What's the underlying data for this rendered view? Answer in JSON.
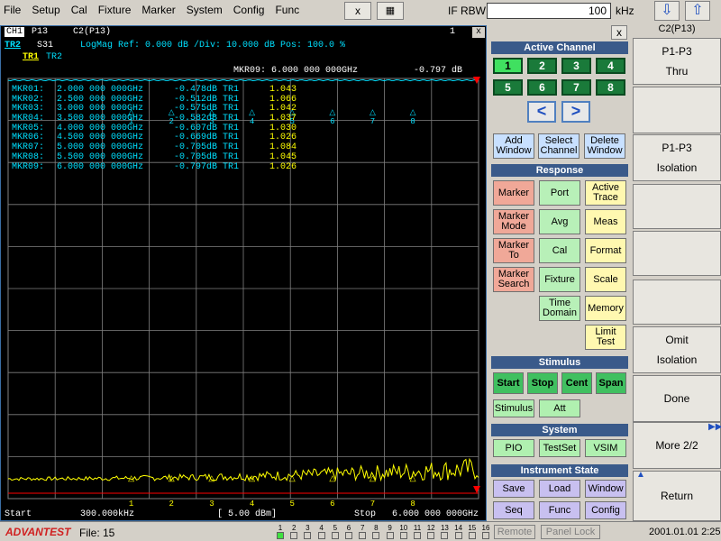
{
  "menu": [
    "File",
    "Setup",
    "Cal",
    "Fixture",
    "Marker",
    "System",
    "Config",
    "Func"
  ],
  "toolbar": {
    "close_label": "x",
    "calc_icon": "calculator-icon",
    "ifrbw_label": "IF RBW",
    "ifrbw_value": "100",
    "ifrbw_unit": "kHz",
    "down_icon": "arrow-down-icon",
    "up_icon": "arrow-up-icon"
  },
  "display": {
    "channel": "CH1",
    "port": "P13",
    "cal": "C2(P13)",
    "window_num": "1",
    "close_label": "x",
    "trace_active": "TR2",
    "sparam": "S31",
    "trace_info": "LogMag  Ref:  0.000 dB  /Div: 10.000 dB  Pos: 100.0 %",
    "trace_tabs": [
      "TR1",
      "TR2"
    ],
    "active_marker": "MKR09:  6.000 000 000GHz",
    "active_marker_value": "-0.797 dB",
    "start_label": "Start",
    "start_value": "300.000kHz",
    "power": "[  5.00 dBm]",
    "stop_label": "Stop",
    "stop_value": "6.000 000 000GHz",
    "colors": {
      "trace1": "#ffff00",
      "trace2": "#00e0ff",
      "grid": "#808080",
      "ref_line": "#ff0000"
    }
  },
  "markers": [
    {
      "name": "MKR01:",
      "freq": "2.000 000 000GHz",
      "v1": "-0.478",
      "unit": "dB TR1",
      "v2": "1.043"
    },
    {
      "name": "MKR02:",
      "freq": "2.500 000 000GHz",
      "v1": "-0.512",
      "unit": "dB TR1",
      "v2": "1.066"
    },
    {
      "name": "MKR03:",
      "freq": "3.000 000 000GHz",
      "v1": "-0.575",
      "unit": "dB TR1",
      "v2": "1.042"
    },
    {
      "name": "MKR04:",
      "freq": "3.500 000 000GHz",
      "v1": "-0.582",
      "unit": "dB TR1",
      "v2": "1.037"
    },
    {
      "name": "MKR05:",
      "freq": "4.000 000 000GHz",
      "v1": "-0.607",
      "unit": "dB TR1",
      "v2": "1.030"
    },
    {
      "name": "MKR06:",
      "freq": "4.500 000 000GHz",
      "v1": "-0.669",
      "unit": "dB TR1",
      "v2": "1.026"
    },
    {
      "name": "MKR07:",
      "freq": "5.000 000 000GHz",
      "v1": "-0.705",
      "unit": "dB TR1",
      "v2": "1.084"
    },
    {
      "name": "MKR08:",
      "freq": "5.500 000 000GHz",
      "v1": "-0.705",
      "unit": "dB TR1",
      "v2": "1.045"
    },
    {
      "name": "MKR09:",
      "freq": "6.000 000 000GHz",
      "v1": "-0.797",
      "unit": "dB TR1",
      "v2": "1.026"
    }
  ],
  "marker_ticks": [
    "1",
    "2",
    "3",
    "4",
    "5",
    "6",
    "7",
    "8"
  ],
  "panel": {
    "close_label": "x",
    "active_channel_title": "Active Channel",
    "channels": [
      "1",
      "2",
      "3",
      "4",
      "5",
      "6",
      "7",
      "8"
    ],
    "prev_label": "<",
    "next_label": ">",
    "window_buttons": [
      "Add Window",
      "Select Channel",
      "Delete Window"
    ],
    "response_title": "Response",
    "response_buttons": [
      [
        "Marker",
        "Port",
        "Active Trace"
      ],
      [
        "Marker Mode",
        "Avg",
        "Meas"
      ],
      [
        "Marker To",
        "Cal",
        "Format"
      ],
      [
        "Marker Search",
        "Fixture",
        "Scale"
      ],
      [
        "",
        "Time Domain",
        "Memory"
      ],
      [
        "",
        "",
        "Limit Test"
      ]
    ],
    "stimulus_title": "Stimulus",
    "stimulus_buttons": [
      "Start",
      "Stop",
      "Cent",
      "Span"
    ],
    "stimulus_row2": [
      "Stimulus",
      "Att"
    ],
    "system_title": "System",
    "system_buttons": [
      "PIO",
      "TestSet",
      "VSIM"
    ],
    "instrument_title": "Instrument State",
    "instrument_buttons": [
      [
        "Save",
        "Load",
        "Window"
      ],
      [
        "Seq",
        "Func",
        "Config"
      ]
    ]
  },
  "softkeys": {
    "header": "C2(P13)",
    "items": [
      {
        "line1": "P1-P3",
        "line2": "Thru"
      },
      {
        "line1": "",
        "line2": ""
      },
      {
        "line1": "P1-P3",
        "line2": "Isolation"
      },
      {
        "line1": "",
        "line2": ""
      },
      {
        "line1": "",
        "line2": ""
      },
      {
        "line1": "Omit",
        "line2": "Isolation"
      },
      {
        "line1": "Done",
        "line2": ""
      },
      {
        "line1": "More 2/2",
        "line2": ""
      },
      {
        "line1": "Return",
        "line2": ""
      }
    ]
  },
  "status": {
    "logo": "ADVANTEST",
    "file": "File: 15",
    "channel_indicators": [
      "1",
      "2",
      "3",
      "4",
      "5",
      "6",
      "7",
      "8",
      "9",
      "10",
      "11",
      "12",
      "13",
      "14",
      "15",
      "16"
    ],
    "remote": "Remote",
    "panel_lock": "Panel Lock",
    "datetime": "2001.01.01  2:25"
  }
}
